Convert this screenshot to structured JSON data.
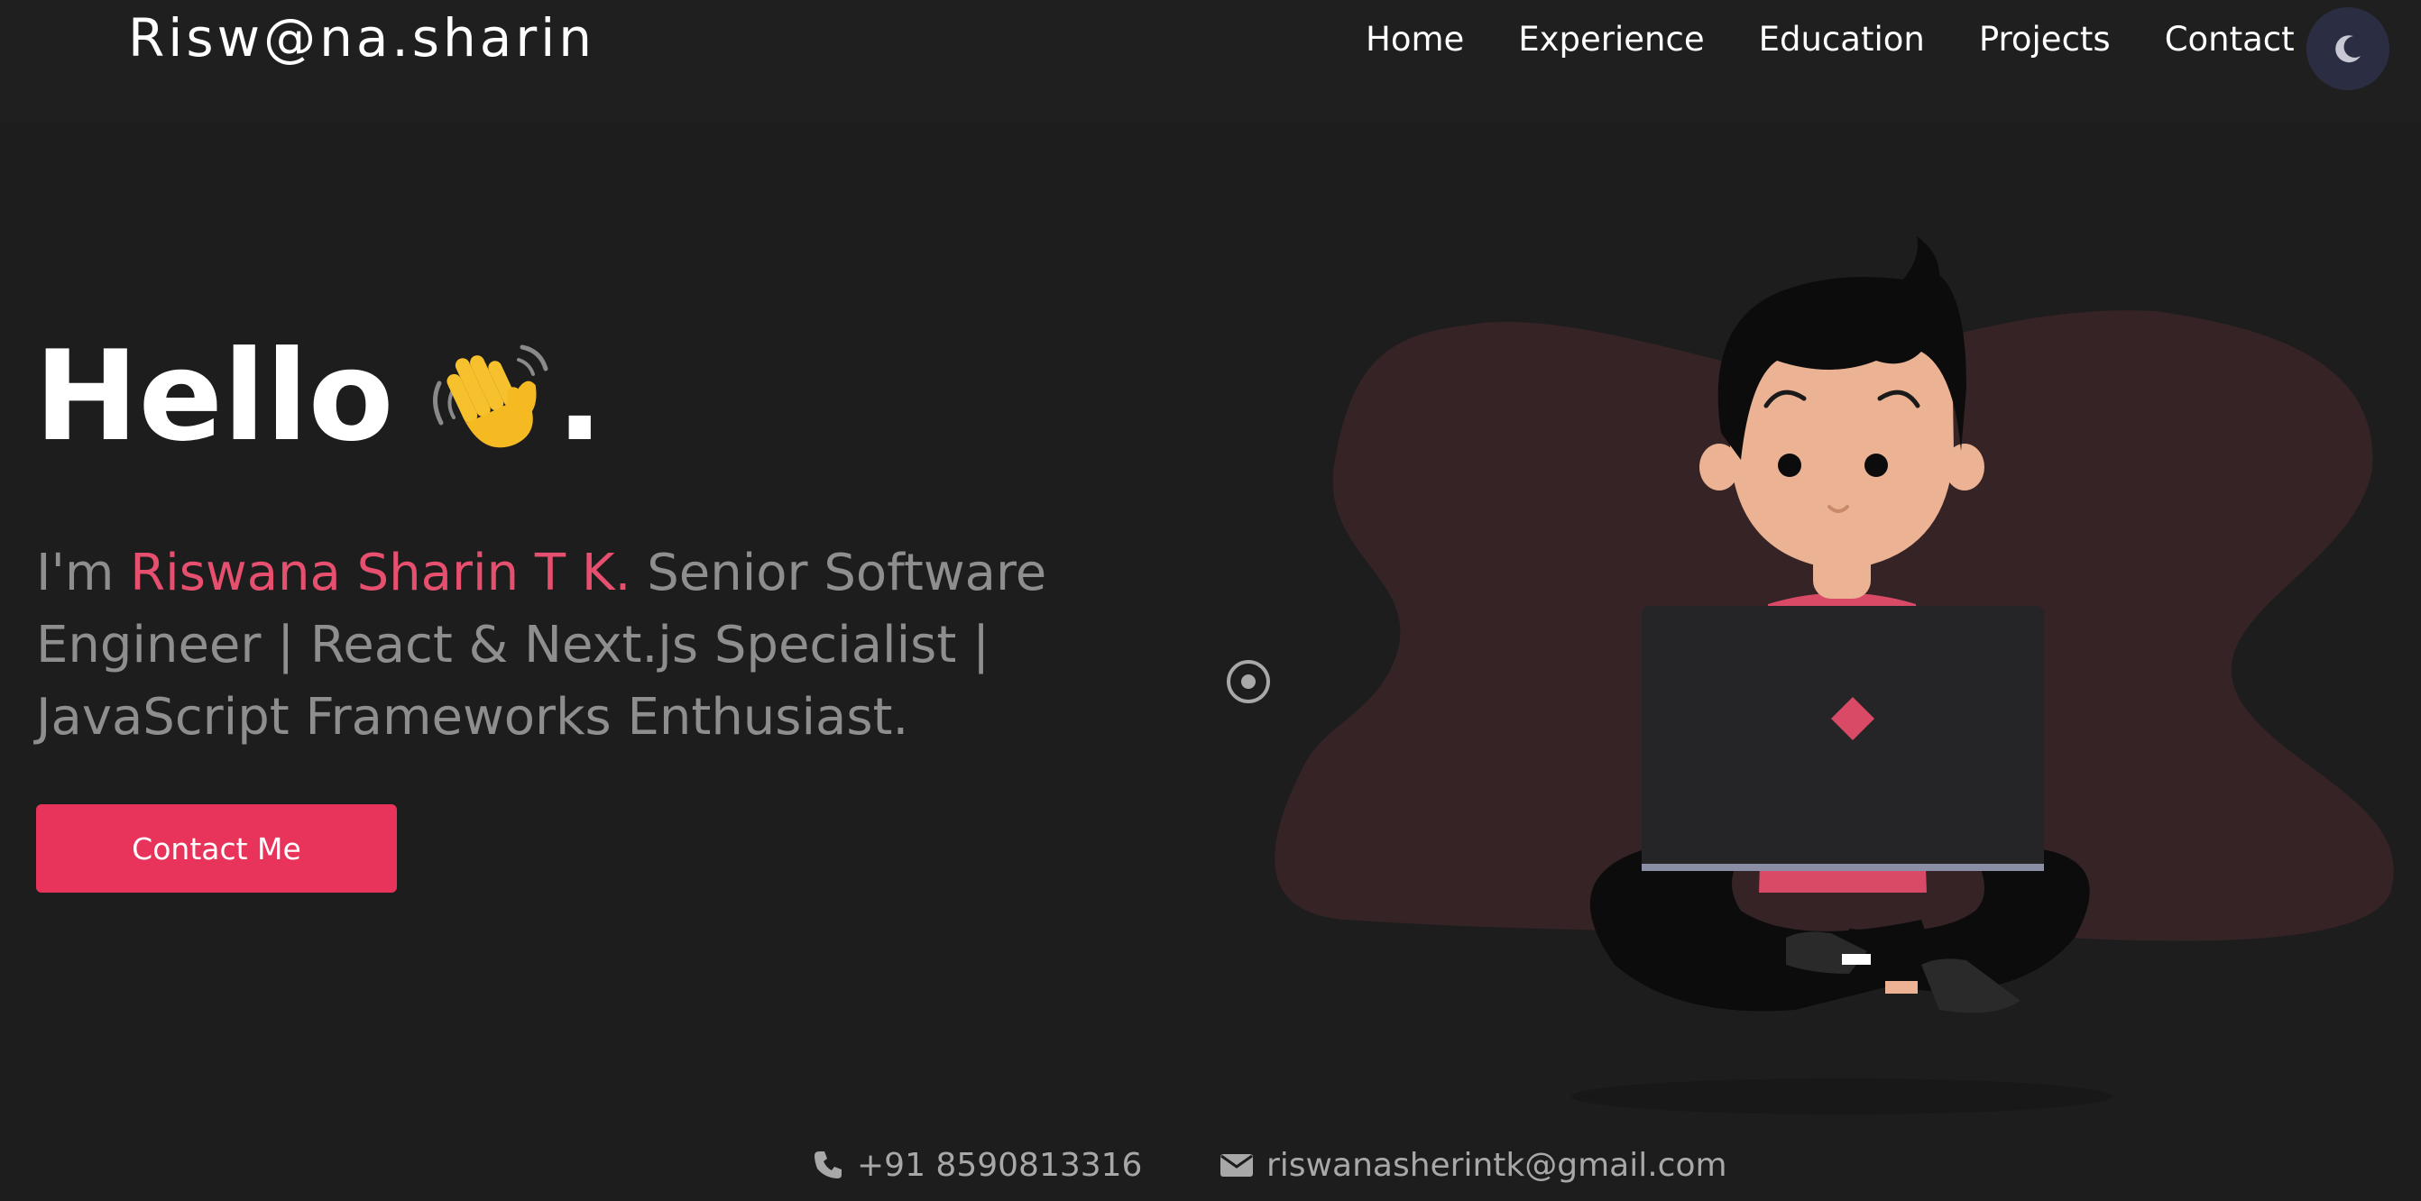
{
  "header": {
    "logo": "Risw@na.sharin",
    "nav": [
      {
        "label": "Home"
      },
      {
        "label": "Experience"
      },
      {
        "label": "Education"
      },
      {
        "label": "Projects"
      },
      {
        "label": "Contact"
      }
    ],
    "theme_toggle_icon": "moon-icon"
  },
  "hero": {
    "hello": "Hello",
    "wave_icon": "waving-hand-icon",
    "dot": ".",
    "intro_prefix": "I'm ",
    "name": "Riswana Sharin T K.",
    "intro_suffix": " Senior Software Engineer | React & Next.js Specialist | JavaScript Frameworks Enthusiast.",
    "contact_button": "Contact Me"
  },
  "footer": {
    "phone_icon": "phone-icon",
    "phone": "+91 8590813316",
    "email_icon": "envelope-icon",
    "email": "riswanasherintk@gmail.com"
  },
  "colors": {
    "background": "#1d1d1d",
    "accent": "#e8345b",
    "name_highlight": "#e64f6e",
    "text_muted": "#8e8e8e",
    "blob": "#352326",
    "toggle_bg": "#2b2d42"
  }
}
